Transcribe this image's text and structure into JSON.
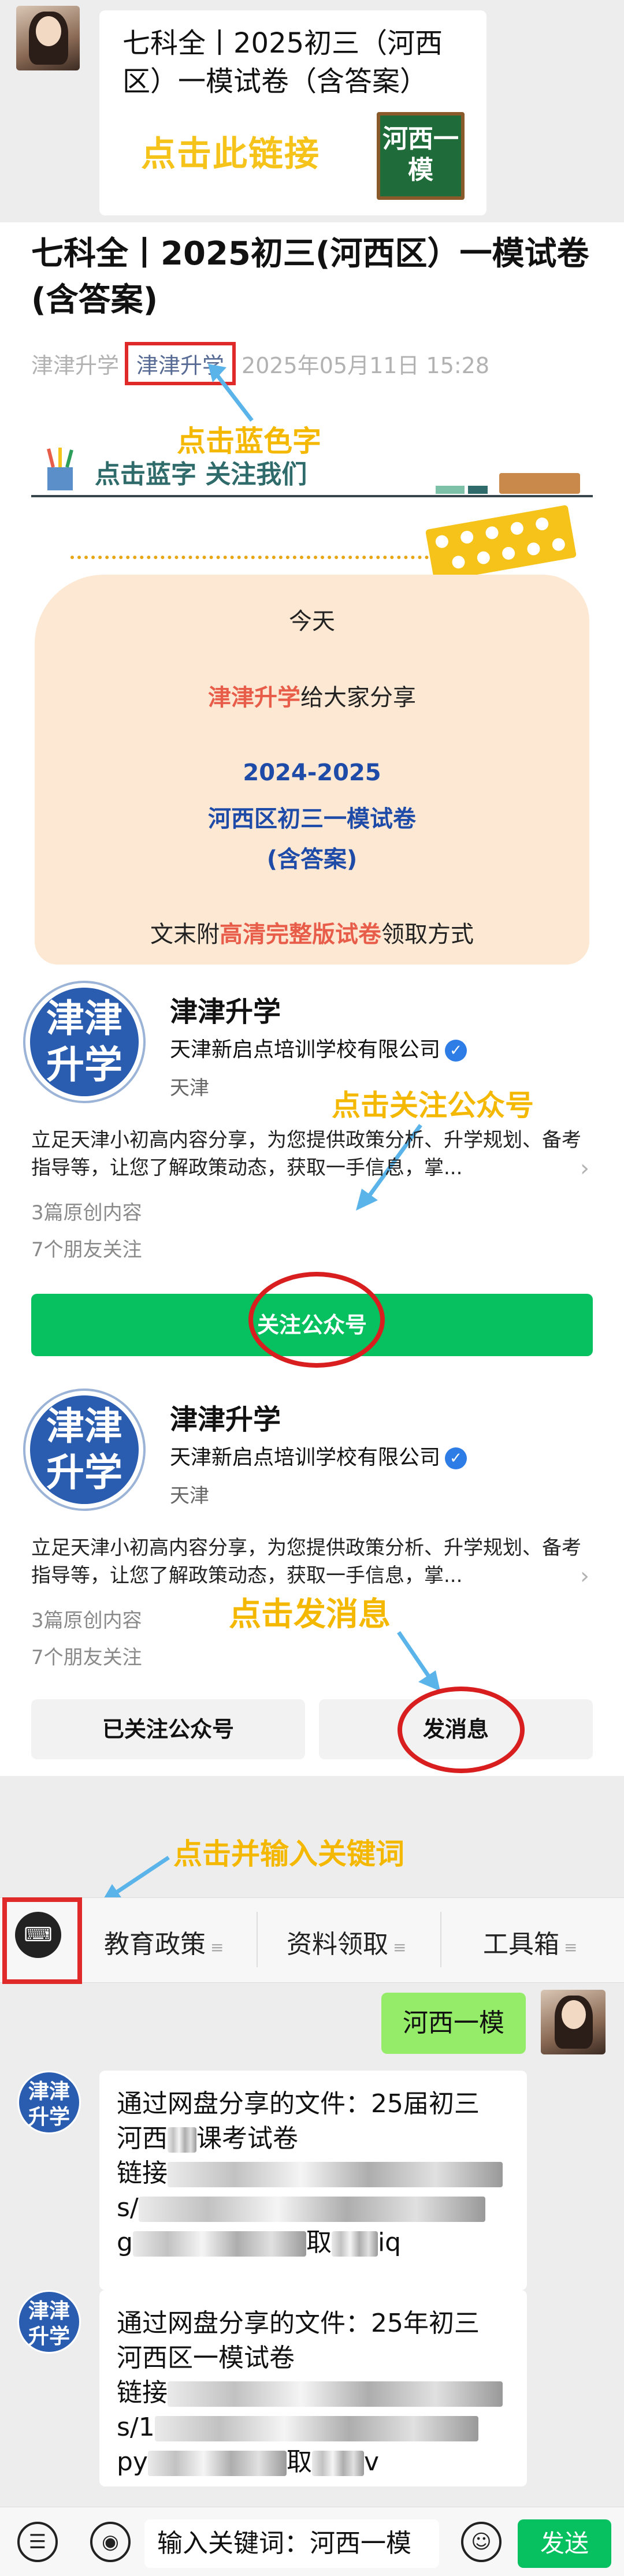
{
  "top_card": {
    "title": "七科全丨2025初三（河西区）一模试卷（含答案）",
    "cta": "点击此链接",
    "thumb": "河西一模"
  },
  "article": {
    "title": "七科全丨2025初三(河西区）一模试卷(含答案)",
    "source": "津津升学",
    "author": "津津升学",
    "time": "2025年05月11日 15:28"
  },
  "annotations": {
    "blue_word": "点击蓝色字",
    "follow_account": "点击关注公众号",
    "send_message": "点击发消息",
    "enter_keyword": "点击并输入关键词"
  },
  "banner": {
    "text": "点击蓝字 关注我们"
  },
  "intro": {
    "today": "今天",
    "share_name": "津津升学",
    "share_rest": "给大家分享",
    "year": "2024-2025",
    "exam": "河西区初三一模试卷",
    "answers": "(含答案)",
    "foot_pre": "文末附",
    "foot_highlight": "高清完整版试卷",
    "foot_post": "领取方式"
  },
  "account": {
    "logo": "津津升学",
    "name": "津津升学",
    "org": "天津新启点培训学校有限公司",
    "city": "天津",
    "desc": "立足天津小初高内容分享，为您提供政策分析、升学规划、备考指导等，让您了解政策动态，获取一手信息，掌...",
    "original": "3篇原创内容",
    "friends": "7个朋友关注",
    "follow_button": "关注公众号",
    "followed_button": "已关注公众号",
    "message_button": "发消息"
  },
  "chat": {
    "menu": [
      "教育政策",
      "资料领取",
      "工具箱"
    ],
    "user_message": "河西一模",
    "bot_messages": [
      {
        "line1": "通过网盘分享的文件：25届初三",
        "line2": "河西",
        "line2b": "课考试卷",
        "line3": "链接",
        "line4": "s/",
        "line5": "g",
        "line5b": "取",
        "line5c": "iq"
      },
      {
        "line1": "通过网盘分享的文件：25年初三",
        "line2": "河西区一模试卷",
        "line3": "链接",
        "line4": "s/1",
        "line5": "py",
        "line5b": "取",
        "line5c": "v"
      }
    ],
    "bot_avatar": "津津升学",
    "input_value": "输入关键词：河西一模",
    "send": "发送"
  },
  "colors": {
    "accent_green": "#07c160",
    "annotation_yellow": "#f5b800",
    "highlight_red": "#e02a2a",
    "link_blue": "#576b95"
  }
}
